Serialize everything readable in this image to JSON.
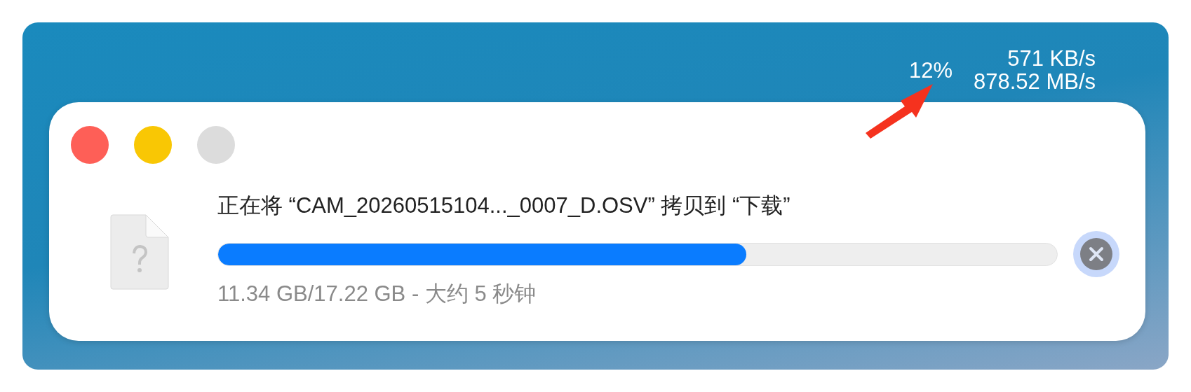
{
  "menu_bar_stats": {
    "percent": "12%",
    "speeds": [
      "571 KB/s",
      "878.52 MB/s"
    ]
  },
  "dialog": {
    "window_controls": [
      {
        "color": "#fe5f57"
      },
      {
        "color": "#f9c704"
      },
      {
        "color": "#dcdcdc"
      }
    ],
    "message": "正在将 “CAM_20260515104..._0007_D.OSV” 拷贝到 “下载”",
    "progress": {
      "level": 0.63
    },
    "status": "11.34 GB/17.22 GB - 大约 5 秒钟"
  }
}
